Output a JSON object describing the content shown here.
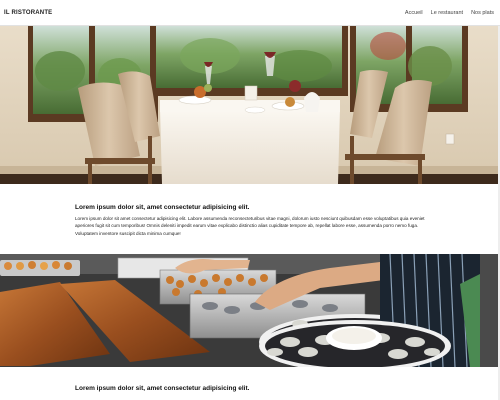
{
  "brand": "IL RISTORANTE",
  "nav": {
    "links": [
      "Accueil",
      "Le restaurant",
      "Nos plats"
    ]
  },
  "section1": {
    "heading": "Lorem ipsum dolor sit, amet consectetur adipisicing elit.",
    "body": "Lorem ipsum dolor sit amet consectetur adipisicing elit. Labore assumenda reconsecteturibus vitae magni, dolorum iusto nesciunt quibusdam esse voluptatibus quia eveniet aperiores fugit sit cum temporibus! Omnis deleniti impedit earum vitae explicabo distinctio alias cupiditate tempore ab, repellat labore esse, assumenda porro nemo fuga. Voluptatem inventore suscipit dicta minima cumque!"
  },
  "section2": {
    "heading": "Lorem ipsum dolor sit, amet consectetur adipisicing elit."
  },
  "colors": {
    "text": "#111111",
    "nav_border": "#e2e2e2",
    "tablecloth": "#f2ede4",
    "window_frame": "#5b3a22",
    "chair": "#cdb79d"
  },
  "images": {
    "hero": "dining-room-photo",
    "kitchen": "kitchen-plating-photo"
  }
}
